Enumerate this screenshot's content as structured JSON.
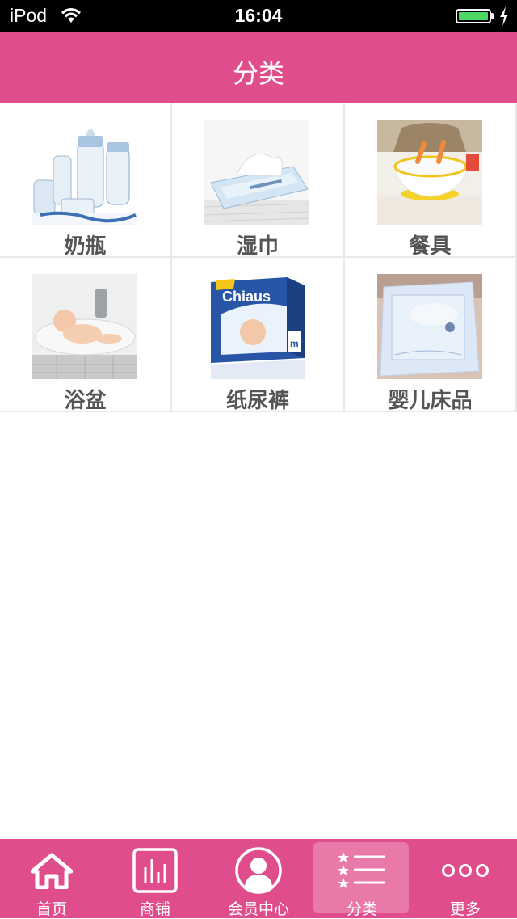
{
  "status_bar": {
    "carrier": "iPod",
    "time": "16:04"
  },
  "header": {
    "title": "分类"
  },
  "categories": [
    {
      "label": "奶瓶",
      "icon": "baby-bottles-image"
    },
    {
      "label": "湿巾",
      "icon": "wet-wipes-image"
    },
    {
      "label": "餐具",
      "icon": "tableware-bowl-image"
    },
    {
      "label": "浴盆",
      "icon": "baby-bath-image"
    },
    {
      "label": "纸尿裤",
      "icon": "diapers-pack-image"
    },
    {
      "label": "婴儿床品",
      "icon": "crib-bedding-image"
    }
  ],
  "tabs": [
    {
      "label": "首页",
      "icon": "home-icon"
    },
    {
      "label": "商铺",
      "icon": "bar-chart-icon"
    },
    {
      "label": "会员中心",
      "icon": "person-icon"
    },
    {
      "label": "分类",
      "icon": "star-list-icon",
      "active": true
    },
    {
      "label": "更多",
      "icon": "more-dots-icon"
    }
  ],
  "colors": {
    "brand": "#e04d8c",
    "battery": "#4cd964"
  },
  "product_texts": {
    "diaper_brand": "Chiaus",
    "diaper_size": "m"
  }
}
